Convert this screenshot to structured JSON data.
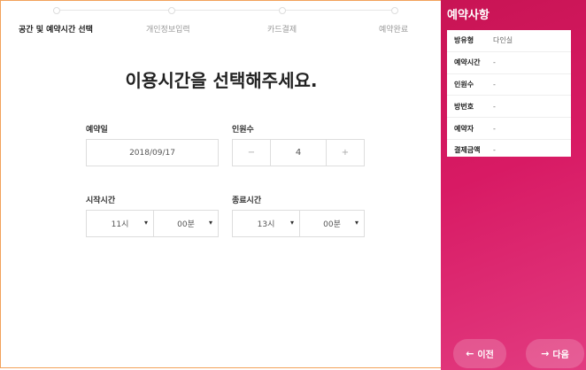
{
  "steps": [
    {
      "label": "공간 및 예약시간 선택"
    },
    {
      "label": "개인정보입력"
    },
    {
      "label": "카드결제"
    },
    {
      "label": "예약완료"
    }
  ],
  "main": {
    "title": "이용시간을 선택해주세요.",
    "date_label": "예약일",
    "date_value": "2018/09/17",
    "people_label": "인원수",
    "people_minus": "−",
    "people_value": "4",
    "people_plus": "+",
    "start_label": "시작시간",
    "start_hour": "11시",
    "start_min": "00분",
    "end_label": "종료시간",
    "end_hour": "13시",
    "end_min": "00분",
    "caret": "▾"
  },
  "side": {
    "title": "예약사항",
    "rows": [
      {
        "k": "방유형",
        "v": "다인실"
      },
      {
        "k": "예약시간",
        "v": "-"
      },
      {
        "k": "인원수",
        "v": "-"
      },
      {
        "k": "방번호",
        "v": "-"
      },
      {
        "k": "예약자",
        "v": "-"
      },
      {
        "k": "결제금액",
        "v": "-"
      }
    ],
    "prev": "이전",
    "next": "다음"
  },
  "colors": {
    "accent": "#d81a64",
    "frame": "#f2a25b"
  }
}
